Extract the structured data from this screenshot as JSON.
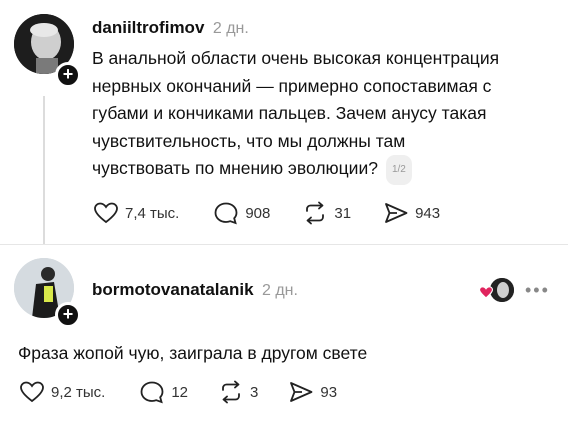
{
  "post1": {
    "username": "daniiltrofimov",
    "time": "2 дн.",
    "text_lines": [
      "В анальной области очень высокая концентрация",
      "нервных окончаний — примерно сопоставимая с",
      "губами и кончиками пальцев. Зачем анусу такая",
      "чувствительность, что мы должны там",
      "чувствовать по мнению эволюции?"
    ],
    "pager": "1/2",
    "likes": "7,4 тыс.",
    "comments": "908",
    "reposts": "31",
    "shares": "943"
  },
  "post2": {
    "username": "bormotovanatalanik",
    "time": "2 дн.",
    "text": "Фраза жопой чую, заиграла в другом свете",
    "likes": "9,2 тыс.",
    "comments": "12",
    "reposts": "3",
    "shares": "93"
  },
  "icons": [
    "plus-icon",
    "heart-icon",
    "comment-icon",
    "repost-icon",
    "share-icon",
    "more-icon"
  ],
  "colors": {
    "text": "#111111",
    "muted": "#999999",
    "line": "#dcdcdc",
    "liked": "#e0245e"
  }
}
